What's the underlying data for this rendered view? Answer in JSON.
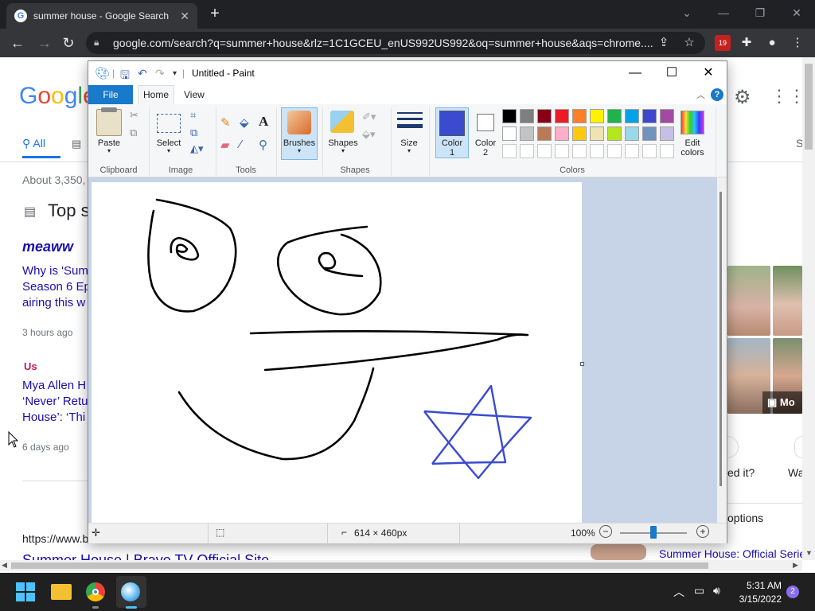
{
  "browser": {
    "tab_title": "summer house - Google Search",
    "url": "google.com/search?q=summer+house&rlz=1C1GCEU_enUS992US992&oq=summer+house&aqs=chrome....",
    "ext_badge": "19"
  },
  "google": {
    "logo": "Google",
    "nav_all": "All",
    "nav_s": "S",
    "about": "About 3,350,",
    "top_stories": "Top s",
    "meaww": "meaww",
    "result1_lines": [
      "Why is 'Sum",
      "Season 6 Ep",
      "airing this w"
    ],
    "result1_time": "3 hours ago",
    "us_logo": "Us",
    "result2_lines": [
      "Mya Allen H",
      "‘Never’ Retu",
      "House’: ‘Thi"
    ],
    "result2_time": "6 days ago",
    "url_line": "https://www.b",
    "site_title": "Summer House | Bravo TV Official Site",
    "more_label": "Mo",
    "ed_it": "ed it?",
    "wa": "Wa",
    "options": "options",
    "official": "Summer House: Official Series"
  },
  "paint": {
    "title": "Untitled - Paint",
    "tabs": {
      "file": "File",
      "home": "Home",
      "view": "View"
    },
    "groups": {
      "clipboard": "Clipboard",
      "image": "Image",
      "tools": "Tools",
      "shapes": "Shapes",
      "colors": "Colors"
    },
    "buttons": {
      "paste": "Paste",
      "select": "Select",
      "brushes": "Brushes",
      "shapes": "Shapes",
      "size": "Size",
      "color1": [
        "Color",
        "1"
      ],
      "color2": [
        "Color",
        "2"
      ],
      "edit_colors": [
        "Edit",
        "colors"
      ]
    },
    "color1": "#3a4bd0",
    "color2": "#ffffff",
    "palette_row1": [
      "#000000",
      "#7f7f7f",
      "#880015",
      "#ed1c24",
      "#ff7f27",
      "#fff200",
      "#22b14c",
      "#00a2e8",
      "#3f48cc",
      "#a349a4"
    ],
    "palette_row2": [
      "#ffffff",
      "#c3c3c3",
      "#b97a57",
      "#ffaec9",
      "#ffc90e",
      "#efe4b0",
      "#b5e61d",
      "#99d9ea",
      "#7092be",
      "#c8bfe7"
    ],
    "status": {
      "size": "614 × 460px",
      "zoom": "100%"
    }
  },
  "taskbar": {
    "time": "5:31 AM",
    "date": "3/15/2022",
    "notifications": "2"
  }
}
